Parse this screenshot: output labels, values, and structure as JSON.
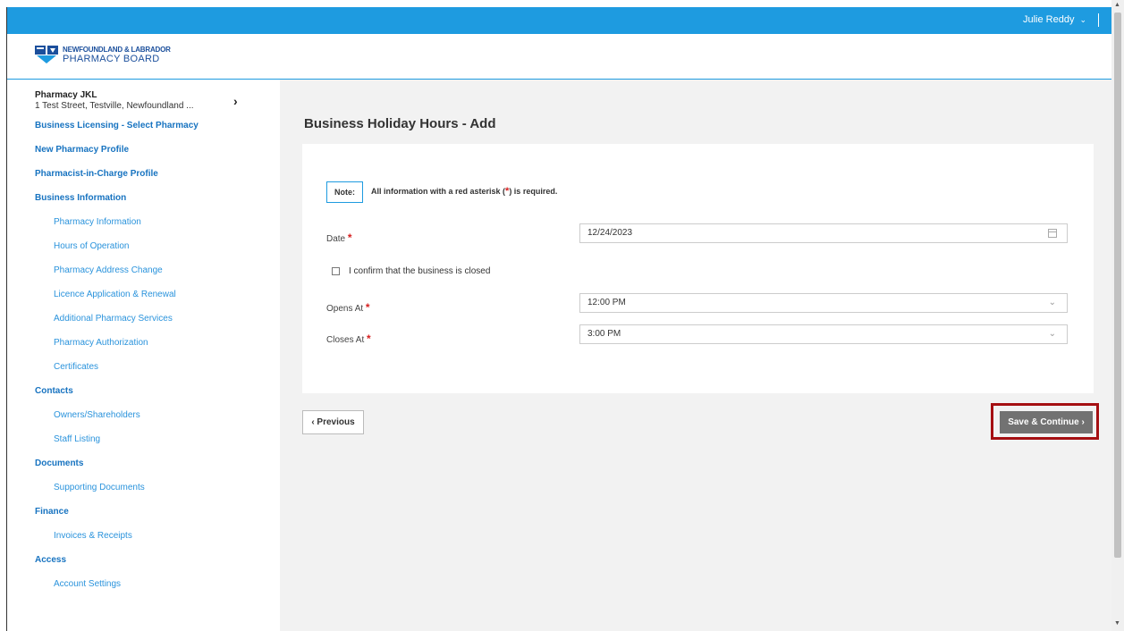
{
  "header": {
    "user_name": "Julie Reddy",
    "user_chevron": "⌄"
  },
  "logo": {
    "line1": "NEWFOUNDLAND & LABRADOR",
    "line2": "PHARMACY BOARD"
  },
  "pharmacy": {
    "name": "Pharmacy JKL",
    "address": "1 Test Street, Testville, Newfoundland ..."
  },
  "sidebar": {
    "items": [
      {
        "label": "Business Licensing - Select Pharmacy"
      },
      {
        "label": "New Pharmacy Profile"
      },
      {
        "label": "Pharmacist-in-Charge Profile"
      },
      {
        "label": "Business Information"
      },
      {
        "label": "Pharmacy Information"
      },
      {
        "label": "Hours of Operation"
      },
      {
        "label": "Pharmacy Address Change"
      },
      {
        "label": "Licence Application & Renewal"
      },
      {
        "label": "Additional Pharmacy Services"
      },
      {
        "label": "Pharmacy Authorization"
      },
      {
        "label": "Certificates"
      },
      {
        "label": "Contacts"
      },
      {
        "label": "Owners/Shareholders"
      },
      {
        "label": "Staff Listing"
      },
      {
        "label": "Documents"
      },
      {
        "label": "Supporting Documents"
      },
      {
        "label": "Finance"
      },
      {
        "label": "Invoices & Receipts"
      },
      {
        "label": "Access"
      },
      {
        "label": "Account Settings"
      }
    ]
  },
  "main": {
    "title": "Business Holiday Hours - Add",
    "note_label": "Note:",
    "note_text_pre": "All information with a red asterisk (",
    "note_text_ast": "*",
    "note_text_post": ") is required.",
    "required_mark": "*",
    "date": {
      "label": "Date",
      "value": "12/24/2023"
    },
    "closed_checkbox": {
      "label": "I confirm that the business is closed",
      "checked": false
    },
    "opens_at": {
      "label": "Opens At",
      "value": "12:00 PM"
    },
    "closes_at": {
      "label": "Closes At",
      "value": "3:00 PM"
    },
    "dropdown_chevron": "⌄",
    "previous_label": "‹ Previous",
    "save_label": "Save & Continue ›"
  },
  "colors": {
    "topbar": "#1e9be0",
    "link": "#1e8fd6",
    "required": "#d62020",
    "highlight": "#a50f12"
  }
}
